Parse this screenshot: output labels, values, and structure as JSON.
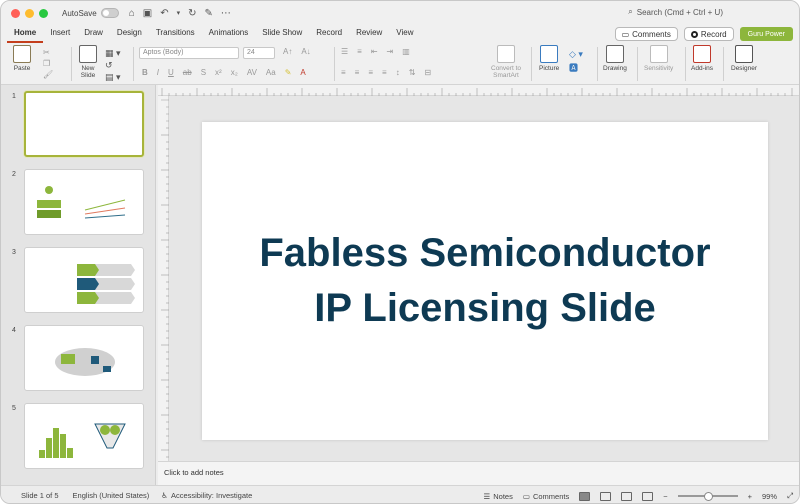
{
  "titlebar": {
    "autosave_label": "AutoSave",
    "search_placeholder": "Search (Cmd + Ctrl + U)"
  },
  "tabs": [
    "Home",
    "Insert",
    "Draw",
    "Design",
    "Transitions",
    "Animations",
    "Slide Show",
    "Record",
    "Review",
    "View"
  ],
  "actions": {
    "comments": "Comments",
    "record": "Record",
    "guru": "Guru Power"
  },
  "ribbon": {
    "paste": "Paste",
    "new_slide_l1": "New",
    "new_slide_l2": "Slide",
    "font_name": "Aptos (Body)",
    "font_size": "24",
    "convert_l1": "Convert to",
    "convert_l2": "SmartArt",
    "picture": "Picture",
    "drawing": "Drawing",
    "sensitivity": "Sensitivity",
    "addins": "Add-ins",
    "designer": "Designer"
  },
  "thumbnails": [
    "1",
    "2",
    "3",
    "4",
    "5"
  ],
  "slide": {
    "title": "Fabless Semiconductor IP Licensing Slide"
  },
  "notes": {
    "placeholder": "Click to add notes"
  },
  "status": {
    "slide_of": "Slide 1 of 5",
    "language": "English (United States)",
    "accessibility": "Accessibility: Investigate",
    "notes": "Notes",
    "comments": "Comments",
    "zoom": "99%"
  },
  "colors": {
    "accent_green": "#8db63c",
    "title_navy": "#0e3a53",
    "tab_underline": "#c43e1c"
  }
}
